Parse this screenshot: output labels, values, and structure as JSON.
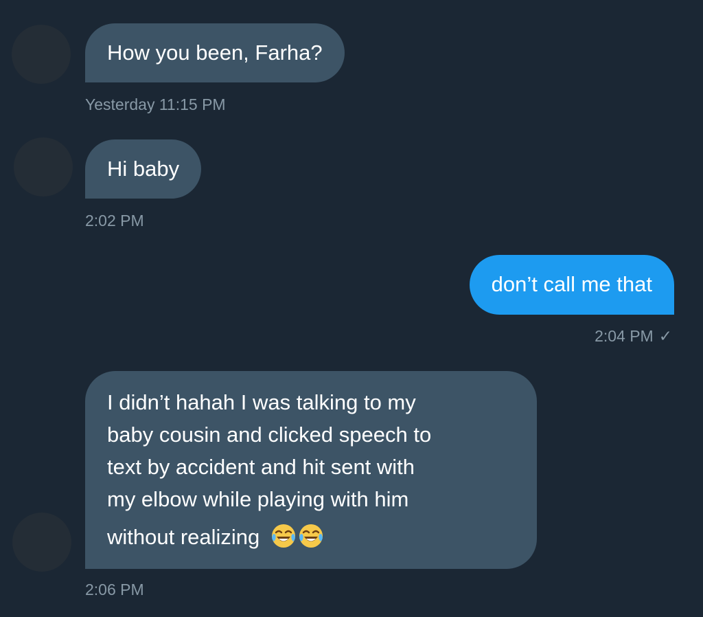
{
  "thread": {
    "messages": [
      {
        "direction": "incoming",
        "text": "How you been, Farha?",
        "timestamp": "Yesterday 11:15 PM"
      },
      {
        "direction": "incoming",
        "text": "Hi baby",
        "timestamp": "2:02 PM"
      },
      {
        "direction": "outgoing",
        "text": "don’t call me that",
        "timestamp": "2:04 PM",
        "status_icon": "✓"
      },
      {
        "direction": "incoming",
        "lines": [
          "I didn’t hahah I was talking to my",
          "baby cousin and clicked speech to",
          "text by accident and hit sent with",
          "my elbow while playing with him",
          "without realizing"
        ],
        "emojis": [
          "face-with-tears-of-joy",
          "face-with-tears-of-joy"
        ],
        "timestamp": "2:06 PM"
      }
    ]
  },
  "colors": {
    "background": "#1b2734",
    "incoming_bubble": "#3d5466",
    "outgoing_bubble": "#1d9bf0",
    "timestamp_text": "#8899a6",
    "avatar_placeholder": "#242d36"
  }
}
